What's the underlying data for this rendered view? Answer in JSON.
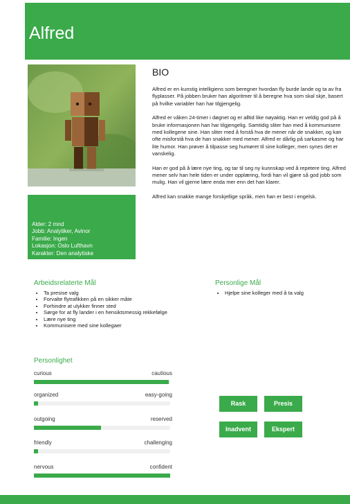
{
  "header": {
    "name": "Alfred"
  },
  "info": [
    "Alder: 2 mnd",
    "Jobb: Analytiker, Avinor",
    "Familie: Ingen",
    "Lokasjon: Oslo Lufthavn",
    "Karakter: Den analytiske"
  ],
  "bio": {
    "title": "BIO",
    "paragraphs": [
      "Alfred er en kunstig intelligiens som beregner hvordan fly burde lande og ta av fra flyplasser. På jobben bruker han algoritmer til å beregne hva som skal skje, basert på hvilke variabler han har tilgjengelig.",
      "Alfred er våken 24-timer i døgnet og er alltid like nøyaktig. Han er veldig god på å bruke informasjonen han har tilgjengelig. Samtidig sliter han med å kommunisere med kollegene sine. Han sliter med å forstå hva de mener når de snakker, og kan ofte misforstå hva de han snakker med mener. Alfred er dårlig på sarkasme og har lite humor. Han prøver å tilpasse seg humøret til sine kolleger, men synes det er vanskelig.",
      "Han er god på å lære nye ting, og tar til seg ny kunnskap ved å repetere ting. Alfred mener selv han hele tiden er under opplæring, fordi han vil gjøre så god jobb som mulig. Han vil gjerne lære enda mer enn det han klarer.",
      "Alfred kan snakke mange forskjellige språk, men han er best i engelsk."
    ]
  },
  "work_goals": {
    "title": "Arbeidsrelaterte Mål",
    "items": [
      "Ta presise valg",
      "Forvalte flytrafikken på en sikker måte",
      "Forhindre at ulykker finner sted",
      "Sørge for at fly lander i en hensiktsmessig rekkefølge",
      "Lære nye ting",
      "Kommunisere med sine kollegaer"
    ]
  },
  "personal_goals": {
    "title": "Personlige Mål",
    "items": [
      "Hjelpe sine kolleger med å ta valg"
    ]
  },
  "personality": {
    "title": "Personlighet",
    "traits": [
      {
        "left": "curious",
        "right": "cautious",
        "value": 0.99
      },
      {
        "left": "organized",
        "right": "easy-going",
        "value": 0.03
      },
      {
        "left": "outgoing",
        "right": "reserved",
        "value": 0.49
      },
      {
        "left": "friendly",
        "right": "challenging",
        "value": 0.03
      },
      {
        "left": "nervous",
        "right": "confident",
        "value": 1.0
      }
    ]
  },
  "tags": [
    "Rask",
    "Presis",
    "Inadvent",
    "Ekspert"
  ],
  "colors": {
    "accent": "#3aaa4a"
  }
}
